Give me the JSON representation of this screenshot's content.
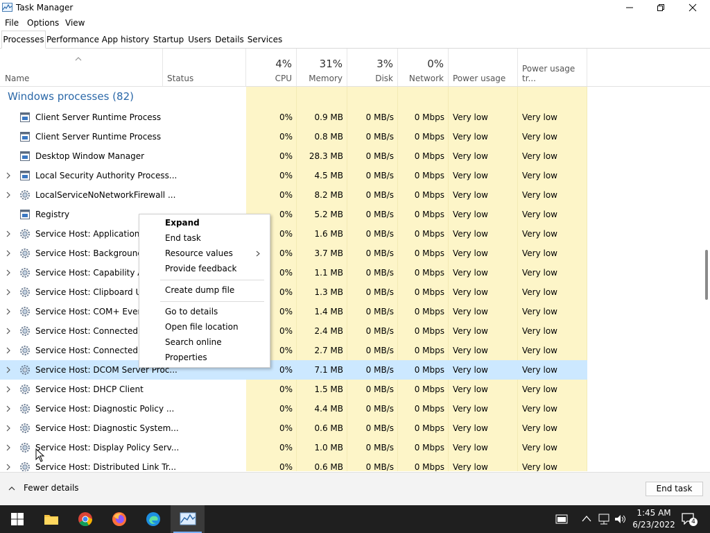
{
  "window": {
    "title": "Task Manager"
  },
  "menu": [
    "File",
    "Options",
    "View"
  ],
  "tabs": [
    "Processes",
    "Performance",
    "App history",
    "Startup",
    "Users",
    "Details",
    "Services"
  ],
  "columns": {
    "name": "Name",
    "status": "Status",
    "cpu": {
      "pct": "4%",
      "label": "CPU"
    },
    "memory": {
      "pct": "31%",
      "label": "Memory"
    },
    "disk": {
      "pct": "3%",
      "label": "Disk"
    },
    "network": {
      "pct": "0%",
      "label": "Network"
    },
    "power": "Power usage",
    "power_trend": "Power usage tr..."
  },
  "group": {
    "label": "Windows processes (82)"
  },
  "rows": [
    {
      "name": "Client Server Runtime Process",
      "expandable": false,
      "icon": "window-icon",
      "cpu": "0%",
      "memory": "0.9 MB",
      "disk": "0 MB/s",
      "network": "0 Mbps",
      "power": "Very low",
      "trend": "Very low"
    },
    {
      "name": "Client Server Runtime Process",
      "expandable": false,
      "icon": "window-icon",
      "cpu": "0%",
      "memory": "0.8 MB",
      "disk": "0 MB/s",
      "network": "0 Mbps",
      "power": "Very low",
      "trend": "Very low"
    },
    {
      "name": "Desktop Window Manager",
      "expandable": false,
      "icon": "window-icon",
      "cpu": "0%",
      "memory": "28.3 MB",
      "disk": "0 MB/s",
      "network": "0 Mbps",
      "power": "Very low",
      "trend": "Very low"
    },
    {
      "name": "Local Security Authority Process...",
      "expandable": true,
      "icon": "window-icon",
      "cpu": "0%",
      "memory": "4.5 MB",
      "disk": "0 MB/s",
      "network": "0 Mbps",
      "power": "Very low",
      "trend": "Very low"
    },
    {
      "name": "LocalServiceNoNetworkFirewall ...",
      "expandable": true,
      "icon": "gear-icon",
      "cpu": "0%",
      "memory": "8.2 MB",
      "disk": "0 MB/s",
      "network": "0 Mbps",
      "power": "Very low",
      "trend": "Very low"
    },
    {
      "name": "Registry",
      "expandable": false,
      "icon": "window-icon",
      "cpu": "0%",
      "memory": "5.2 MB",
      "disk": "0 MB/s",
      "network": "0 Mbps",
      "power": "Very low",
      "trend": "Very low"
    },
    {
      "name": "Service Host: Application Inf",
      "expandable": true,
      "icon": "gear-icon",
      "cpu": "0%",
      "memory": "1.6 MB",
      "disk": "0 MB/s",
      "network": "0 Mbps",
      "power": "Very low",
      "trend": "Very low"
    },
    {
      "name": "Service Host: Background In",
      "expandable": true,
      "icon": "gear-icon",
      "cpu": "0%",
      "memory": "3.7 MB",
      "disk": "0 MB/s",
      "network": "0 Mbps",
      "power": "Very low",
      "trend": "Very low"
    },
    {
      "name": "Service Host: Capability Acc",
      "expandable": true,
      "icon": "gear-icon",
      "cpu": "0%",
      "memory": "1.1 MB",
      "disk": "0 MB/s",
      "network": "0 Mbps",
      "power": "Very low",
      "trend": "Very low"
    },
    {
      "name": "Service Host: Clipboard User",
      "expandable": true,
      "icon": "gear-icon",
      "cpu": "0%",
      "memory": "1.3 MB",
      "disk": "0 MB/s",
      "network": "0 Mbps",
      "power": "Very low",
      "trend": "Very low"
    },
    {
      "name": "Service Host: COM+ Event S",
      "expandable": true,
      "icon": "gear-icon",
      "cpu": "0%",
      "memory": "1.4 MB",
      "disk": "0 MB/s",
      "network": "0 Mbps",
      "power": "Very low",
      "trend": "Very low"
    },
    {
      "name": "Service Host: Connected Dev",
      "expandable": true,
      "icon": "gear-icon",
      "cpu": "0%",
      "memory": "2.4 MB",
      "disk": "0 MB/s",
      "network": "0 Mbps",
      "power": "Very low",
      "trend": "Very low"
    },
    {
      "name": "Service Host: Connected Dev",
      "expandable": true,
      "icon": "gear-icon",
      "cpu": "0%",
      "memory": "2.7 MB",
      "disk": "0 MB/s",
      "network": "0 Mbps",
      "power": "Very low",
      "trend": "Very low"
    },
    {
      "name": "Service Host: DCOM Server Proc...",
      "expandable": true,
      "icon": "gear-icon",
      "selected": true,
      "cpu": "0%",
      "memory": "7.1 MB",
      "disk": "0 MB/s",
      "network": "0 Mbps",
      "power": "Very low",
      "trend": "Very low"
    },
    {
      "name": "Service Host: DHCP Client",
      "expandable": true,
      "icon": "gear-icon",
      "cpu": "0%",
      "memory": "1.5 MB",
      "disk": "0 MB/s",
      "network": "0 Mbps",
      "power": "Very low",
      "trend": "Very low"
    },
    {
      "name": "Service Host: Diagnostic Policy ...",
      "expandable": true,
      "icon": "gear-icon",
      "cpu": "0%",
      "memory": "4.4 MB",
      "disk": "0 MB/s",
      "network": "0 Mbps",
      "power": "Very low",
      "trend": "Very low"
    },
    {
      "name": "Service Host: Diagnostic System...",
      "expandable": true,
      "icon": "gear-icon",
      "cpu": "0%",
      "memory": "0.6 MB",
      "disk": "0 MB/s",
      "network": "0 Mbps",
      "power": "Very low",
      "trend": "Very low"
    },
    {
      "name": "Service Host: Display Policy Serv...",
      "expandable": true,
      "icon": "gear-icon",
      "cpu": "0%",
      "memory": "1.0 MB",
      "disk": "0 MB/s",
      "network": "0 Mbps",
      "power": "Very low",
      "trend": "Very low"
    },
    {
      "name": "Service Host: Distributed Link Tr...",
      "expandable": true,
      "icon": "gear-icon",
      "cpu": "0%",
      "memory": "0.6 MB",
      "disk": "0 MB/s",
      "network": "0 Mbps",
      "power": "Very low",
      "trend": "Very low"
    }
  ],
  "context_menu": {
    "groups": [
      [
        "Expand",
        "End task",
        "Resource values",
        "Provide feedback"
      ],
      [
        "Create dump file"
      ],
      [
        "Go to details",
        "Open file location",
        "Search online",
        "Properties"
      ]
    ],
    "bold_item": "Expand",
    "submenu_item": "Resource values"
  },
  "footer": {
    "fewer_details": "Fewer details",
    "end_task": "End task"
  },
  "taskbar": {
    "apps": [
      "windows-start-icon",
      "file-explorer-icon",
      "chrome-icon",
      "firefox-icon",
      "edge-icon",
      "task-manager-icon"
    ],
    "time": "1:45 AM",
    "date": "6/23/2022",
    "notification_count": "4"
  },
  "colors": {
    "accent": "#2b68a8",
    "highlight": "#fdf5c8",
    "selected": "#cce8ff",
    "taskbar": "#1f1f1f"
  }
}
